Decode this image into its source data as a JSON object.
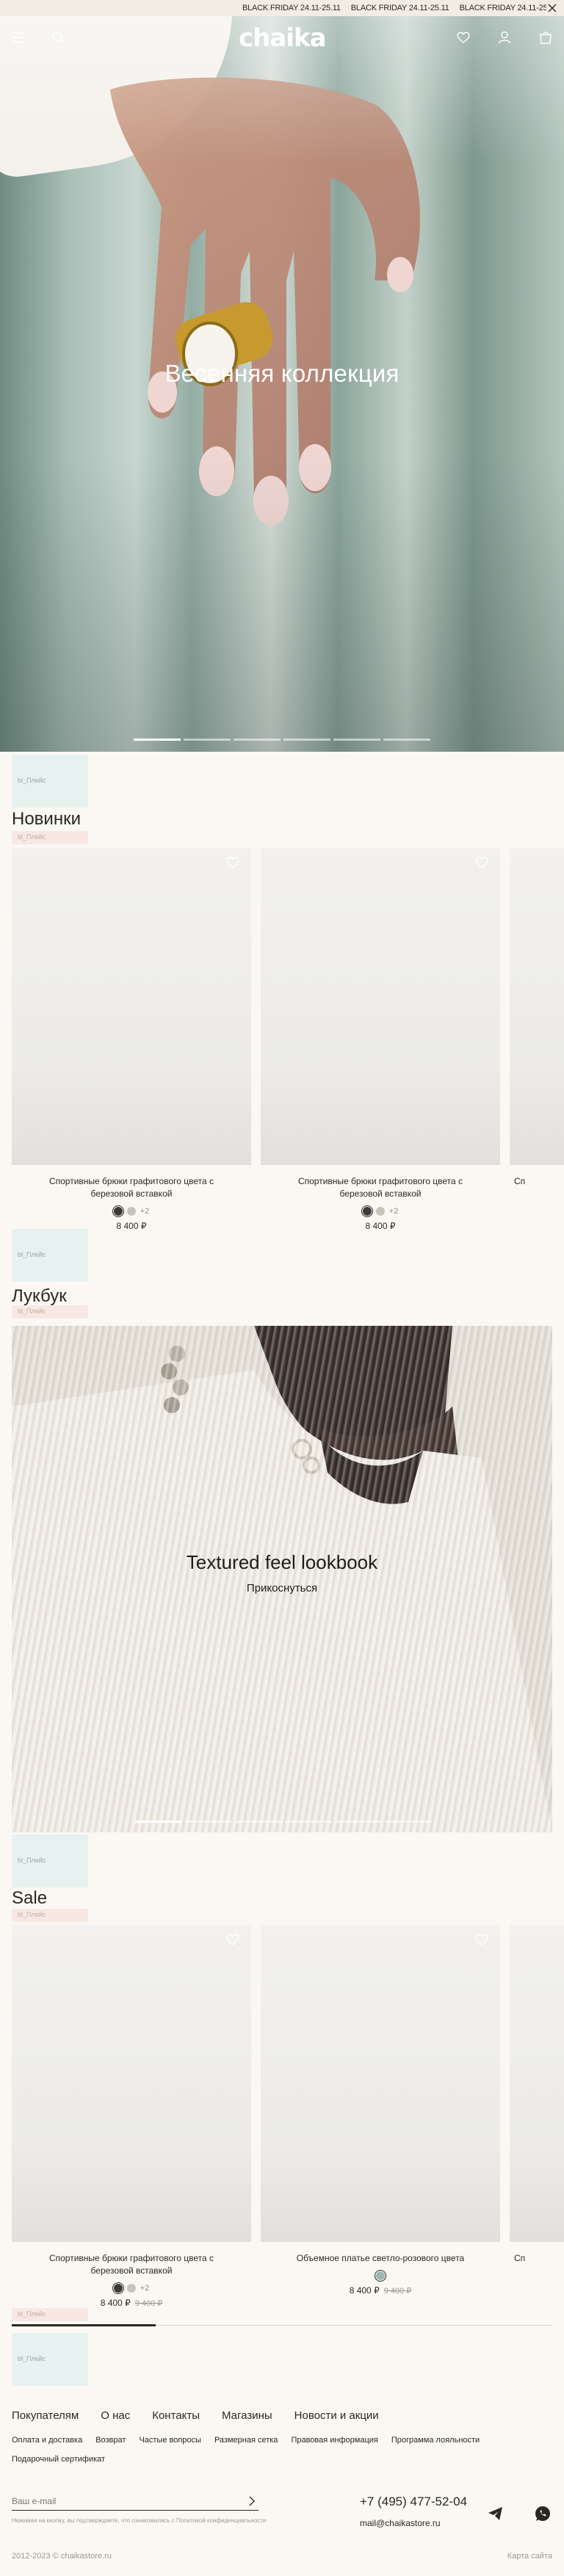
{
  "announcement": {
    "ticker": [
      "BLACK FRIDAY 24.11-25.11",
      "BLACK FRIDAY 24.11-25.11",
      "BLACK FRIDAY 24.11-25.11"
    ],
    "close_icon": "close-icon"
  },
  "header": {
    "logo": "chaika",
    "icons": [
      "menu-icon",
      "search-icon",
      "heart-icon",
      "user-icon",
      "cart-icon"
    ]
  },
  "hero": {
    "title": "Весенняя коллекция",
    "slides": 6,
    "active_slide": 1
  },
  "placeholders": {
    "block_label": "bl_Плейс",
    "strip_label": "bl_Плейс"
  },
  "new_arrivals": {
    "title": "Новинки",
    "products": [
      {
        "name": "Спортивные брюки графитового цвета с березовой вставкой",
        "price": "8 400 ₽",
        "more_colors": "+2",
        "swatches": [
          "#3a3a36",
          "#c9c4bb"
        ]
      },
      {
        "name": "Спортивные брюки графитового цвета с березовой вставкой",
        "price": "8 400 ₽",
        "more_colors": "+2",
        "swatches": [
          "#3a3a36",
          "#c9c4bb"
        ]
      },
      {
        "name": "Сп",
        "price": "",
        "more_colors": "",
        "swatches": []
      }
    ]
  },
  "lookbook": {
    "title": "Лукбук",
    "banner_title": "Textured feel lookbook",
    "banner_link": "Прикоснуться",
    "slides": 6,
    "active_slide": 1
  },
  "sale": {
    "title": "Sale",
    "products": [
      {
        "name": "Спортивные брюки графитового цвета с березовой вставкой",
        "price": "8 400 ₽",
        "old_price": "9 400 ₽",
        "more_colors": "+2",
        "swatches": [
          "#3a3a36",
          "#c9c4bb"
        ]
      },
      {
        "name": "Объемное платье светло-розового цвета",
        "price": "8 400 ₽",
        "old_price": "9 400 ₽",
        "more_colors": "",
        "swatches": [
          "#9db9b6"
        ]
      },
      {
        "name": "Сп",
        "price": "",
        "old_price": "",
        "more_colors": "",
        "swatches": []
      }
    ],
    "scroll_progress": 0.27
  },
  "footer": {
    "nav": [
      "Покупателям",
      "О нас",
      "Контакты",
      "Магазины",
      "Новости и акции"
    ],
    "links": [
      "Оплата и доставка",
      "Возврат",
      "Частые вопросы",
      "Размерная сетка",
      "Правовая информация",
      "Программа лояльности"
    ],
    "gift": "Подарочный сертификат",
    "email_placeholder": "Ваш e-mail",
    "consent": "Нажимая на кнопку, вы подтверждаете, что ознакомились с Политикой конфиденциальности",
    "phone": "+7 (495) 477-52-04",
    "email": "mail@chaikastore.ru",
    "social_icons": [
      "telegram-icon",
      "whatsapp-icon"
    ],
    "copyright": "2012-2023 © chaikastore.ru",
    "sitemap": "Карта сайта"
  }
}
